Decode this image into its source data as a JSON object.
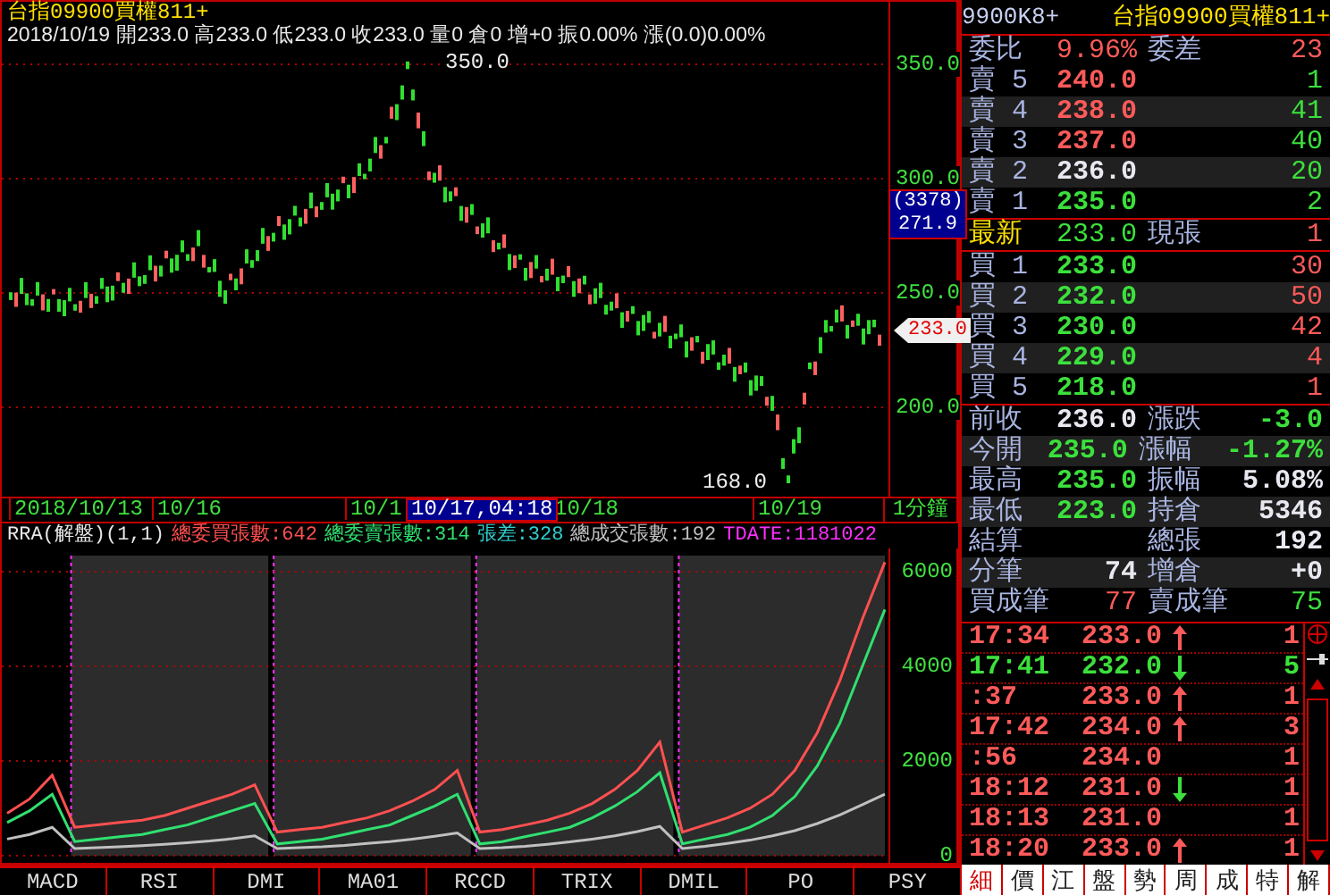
{
  "header": {
    "title": "台指09900買權811+",
    "info": "2018/10/19 開233.0 高233.0 低233.0 收233.0 量0 倉0 增+0 振0.00% 漲(0.0)0.00%"
  },
  "price_axis": {
    "ticks": [
      "350.0",
      "300.0",
      "250.0",
      "200.0"
    ],
    "cursor_count": "(3378)",
    "cursor_price": "271.9",
    "last_price": "233.0",
    "high_label": "350.0",
    "low_label": "168.0"
  },
  "time_axis": {
    "labels": [
      "2018/10/13",
      "10/16",
      "10/1",
      "10/18",
      "10/19"
    ],
    "cursor": "10/17,04:18",
    "period": "1分鐘"
  },
  "indicator": {
    "name": "RRA(解盤)(1,1)",
    "legend": [
      {
        "text": "總委買張數:642",
        "color": "#ff5050"
      },
      {
        "text": "總委賣張數:314",
        "color": "#30e070"
      },
      {
        "text": "張差:328",
        "color": "#30d0d0"
      },
      {
        "text": "總成交張數:192",
        "color": "#c0c0c0"
      },
      {
        "text": "TDATE:1181022",
        "color": "#ff30ff"
      }
    ],
    "chart_data": {
      "type": "line",
      "grid": true,
      "ylim": [
        0,
        6400
      ],
      "yticks": [
        6000,
        4000,
        2000,
        0
      ],
      "series": [
        {
          "color": "#ff5050",
          "values": [
            900,
            1200,
            1700,
            600,
            650,
            700,
            750,
            850,
            1000,
            1150,
            1300,
            1500,
            500,
            550,
            600,
            700,
            800,
            950,
            1150,
            1400,
            1800,
            500,
            550,
            650,
            750,
            900,
            1100,
            1400,
            1800,
            2400,
            500,
            650,
            800,
            1000,
            1300,
            1800,
            2600,
            3700,
            5000,
            6200
          ]
        },
        {
          "color": "#30e070",
          "values": [
            700,
            950,
            1300,
            300,
            350,
            400,
            450,
            550,
            650,
            800,
            950,
            1100,
            250,
            300,
            350,
            450,
            550,
            650,
            850,
            1050,
            1300,
            250,
            300,
            400,
            500,
            600,
            800,
            1050,
            1350,
            1750,
            250,
            350,
            450,
            600,
            850,
            1250,
            1900,
            2800,
            4000,
            5200
          ]
        },
        {
          "color": "#c0c0c0",
          "values": [
            350,
            450,
            600,
            150,
            170,
            190,
            210,
            240,
            270,
            310,
            360,
            420,
            150,
            170,
            190,
            220,
            260,
            300,
            350,
            410,
            480,
            150,
            170,
            200,
            240,
            290,
            350,
            420,
            510,
            620,
            150,
            200,
            260,
            330,
            420,
            530,
            680,
            860,
            1080,
            1300
          ]
        }
      ]
    }
  },
  "indicator_tabs": [
    "MACD",
    "RSI",
    "DMI",
    "MA01",
    "RCCD",
    "TRIX",
    "DMIL",
    "PO",
    "PSY"
  ],
  "quote": {
    "code": "9900K8+",
    "title": "台指09900買權811+",
    "ratio": {
      "label": "委比",
      "value": "9.96%",
      "diff_label": "委差",
      "diff": "23"
    },
    "asks": [
      {
        "label": "賣 5",
        "price": "240.0",
        "qty": "1"
      },
      {
        "label": "賣 4",
        "price": "238.0",
        "qty": "41"
      },
      {
        "label": "賣 3",
        "price": "237.0",
        "qty": "40"
      },
      {
        "label": "賣 2",
        "price": "236.0",
        "qty": "20"
      },
      {
        "label": "賣 1",
        "price": "235.0",
        "qty": "2"
      }
    ],
    "last": {
      "label": "最新",
      "price": "233.0",
      "vol_label": "現張",
      "vol": "1"
    },
    "bids": [
      {
        "label": "買 1",
        "price": "233.0",
        "qty": "30"
      },
      {
        "label": "買 2",
        "price": "232.0",
        "qty": "50"
      },
      {
        "label": "買 3",
        "price": "230.0",
        "qty": "42"
      },
      {
        "label": "買 4",
        "price": "229.0",
        "qty": "4"
      },
      {
        "label": "買 5",
        "price": "218.0",
        "qty": "1"
      }
    ],
    "stats": [
      {
        "left": {
          "kind": "price",
          "label": "前收",
          "value": "236.0"
        },
        "right": {
          "kind": "change",
          "label": "漲跌",
          "value": "-3.0"
        }
      },
      {
        "left": {
          "kind": "price",
          "label": "今開",
          "value": "235.0"
        },
        "right": {
          "kind": "change",
          "label": "漲幅",
          "value": "-1.27%"
        }
      },
      {
        "left": {
          "kind": "price",
          "label": "最高",
          "value": "235.0"
        },
        "right": {
          "kind": "plain",
          "label": "振幅",
          "value": "5.08%"
        }
      },
      {
        "left": {
          "kind": "price",
          "label": "最低",
          "value": "223.0"
        },
        "right": {
          "kind": "plain",
          "label": "持倉",
          "value": "5346"
        }
      },
      {
        "left": {
          "label": "結算"
        },
        "right": {
          "kind": "plain",
          "label": "總張",
          "value": "192"
        }
      },
      {
        "left": {
          "kind": "plain",
          "label": "分筆",
          "value": "74"
        },
        "right": {
          "kind": "plain",
          "label": "增倉",
          "value": "+0"
        }
      }
    ],
    "counts": {
      "buy_label": "買成筆",
      "buy": "77",
      "sell_label": "賣成筆",
      "sell": "75"
    }
  },
  "trades": [
    {
      "kind": "up",
      "time": "17:34",
      "price": "233.0",
      "qty": "1",
      "color": "#ff5a5a"
    },
    {
      "kind": "down",
      "time": "17:41",
      "price": "232.0",
      "qty": "5",
      "color": "#3ce03c"
    },
    {
      "kind": "up",
      "time": ":37",
      "price": "233.0",
      "qty": "1",
      "color": "#ff5a5a"
    },
    {
      "kind": "up",
      "time": "17:42",
      "price": "234.0",
      "qty": "3",
      "color": "#ff5a5a"
    },
    {
      "kind": "plain",
      "time": ":56",
      "price": "234.0",
      "qty": "1",
      "color": "#ff5a5a"
    },
    {
      "kind": "down",
      "time": "18:12",
      "price": "231.0",
      "qty": "1",
      "color": "#ff5a5a"
    },
    {
      "kind": "plain",
      "time": "18:13",
      "price": "231.0",
      "qty": "1",
      "color": "#ff5a5a"
    },
    {
      "kind": "up",
      "time": "18:20",
      "price": "233.0",
      "qty": "1",
      "color": "#ff5a5a"
    }
  ],
  "panel_tabs": [
    {
      "label": "細",
      "selected": true
    },
    {
      "label": "價",
      "selected": false
    },
    {
      "label": "江",
      "selected": false
    },
    {
      "label": "盤",
      "selected": false
    },
    {
      "label": "勢",
      "selected": false
    },
    {
      "label": "周",
      "selected": false
    },
    {
      "label": "成",
      "selected": false
    },
    {
      "label": "特",
      "selected": false
    },
    {
      "label": "解",
      "selected": false
    }
  ]
}
